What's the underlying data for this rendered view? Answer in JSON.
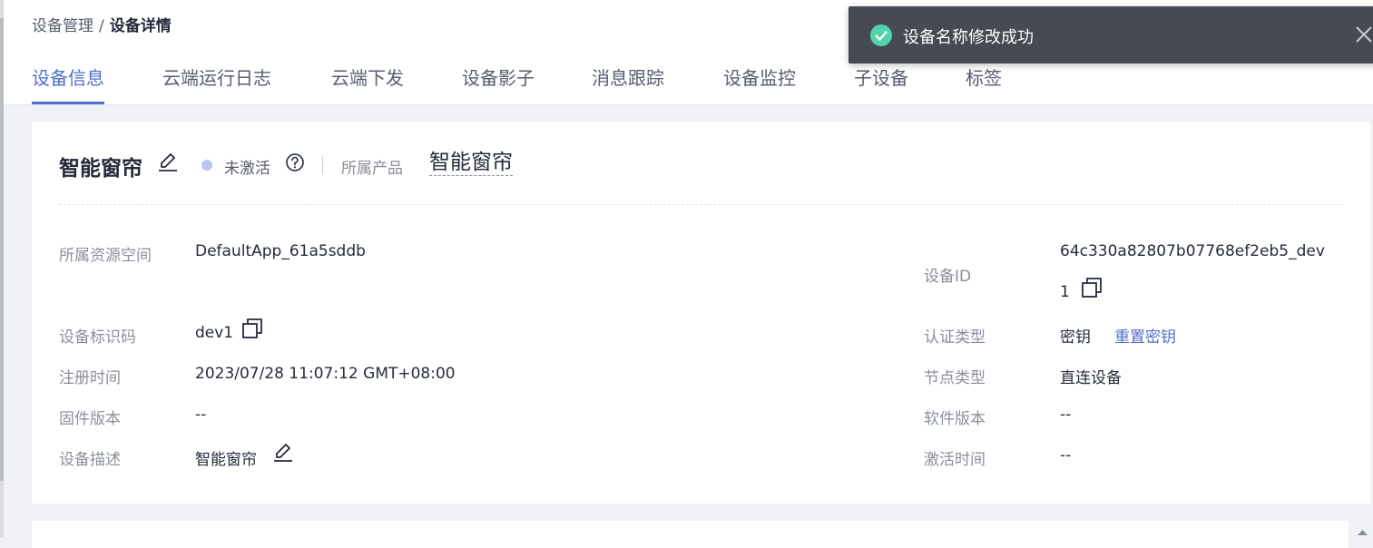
{
  "breadcrumb": {
    "parent": "设备管理",
    "separator": "/",
    "current": "设备详情"
  },
  "tabs": [
    {
      "label": "设备信息",
      "active": true
    },
    {
      "label": "云端运行日志",
      "active": false
    },
    {
      "label": "云端下发",
      "active": false
    },
    {
      "label": "设备影子",
      "active": false
    },
    {
      "label": "消息跟踪",
      "active": false
    },
    {
      "label": "设备监控",
      "active": false
    },
    {
      "label": "子设备",
      "active": false
    },
    {
      "label": "标签",
      "active": false
    }
  ],
  "device": {
    "name": "智能窗帘",
    "status": "未激活",
    "product_label": "所属产品",
    "product_value": "智能窗帘"
  },
  "details_left": [
    {
      "label": "所属资源空间",
      "value": "DefaultApp_61a5sddb"
    },
    {
      "label": "设备标识码",
      "value": "dev1"
    },
    {
      "label": "注册时间",
      "value": "2023/07/28 11:07:12 GMT+08:00"
    },
    {
      "label": "固件版本",
      "value": "--"
    },
    {
      "label": "设备描述",
      "value": "智能窗帘"
    }
  ],
  "details_right": {
    "device_id_label": "设备ID",
    "device_id_line1": "64c330a82807b07768ef2eb5_dev",
    "device_id_line2": "1",
    "auth_type_label": "认证类型",
    "auth_type_value": "密钥",
    "reset_key_link": "重置密钥",
    "node_type_label": "节点类型",
    "node_type_value": "直连设备",
    "software_version_label": "软件版本",
    "software_version_value": "--",
    "activation_time_label": "激活时间",
    "activation_time_value": "--"
  },
  "toast": {
    "message": "设备名称修改成功",
    "type": "success"
  },
  "colors": {
    "accent": "#526ecc",
    "toast_bg": "#464a53",
    "success": "#50d4ab",
    "status_inactive": "#bcc5f2"
  }
}
